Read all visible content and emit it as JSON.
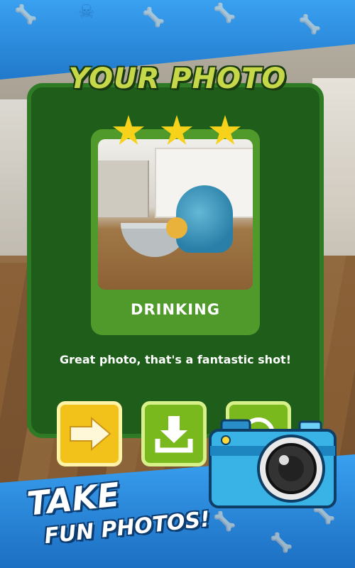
{
  "header": {
    "title": "YOUR PHOTO"
  },
  "photo_card": {
    "rating": {
      "stars": 3,
      "max": 3
    },
    "label": "DRINKING"
  },
  "message": "Great photo, that's a fantastic shot!",
  "actions": [
    {
      "name": "next",
      "icon": "arrow-right-icon",
      "color": "#f2c21b"
    },
    {
      "name": "save",
      "icon": "download-icon",
      "color": "#79b91e"
    },
    {
      "name": "share",
      "icon": "share-icon",
      "color": "#79b91e"
    }
  ],
  "promo": {
    "line1": "TAKE",
    "line2": "FUN PHOTOS!"
  },
  "colors": {
    "banner": "#2e8fe0",
    "panel": "#1e5e1a",
    "card": "#4f9a2a",
    "title": "#c6d84a",
    "star": "#f7d21a"
  }
}
